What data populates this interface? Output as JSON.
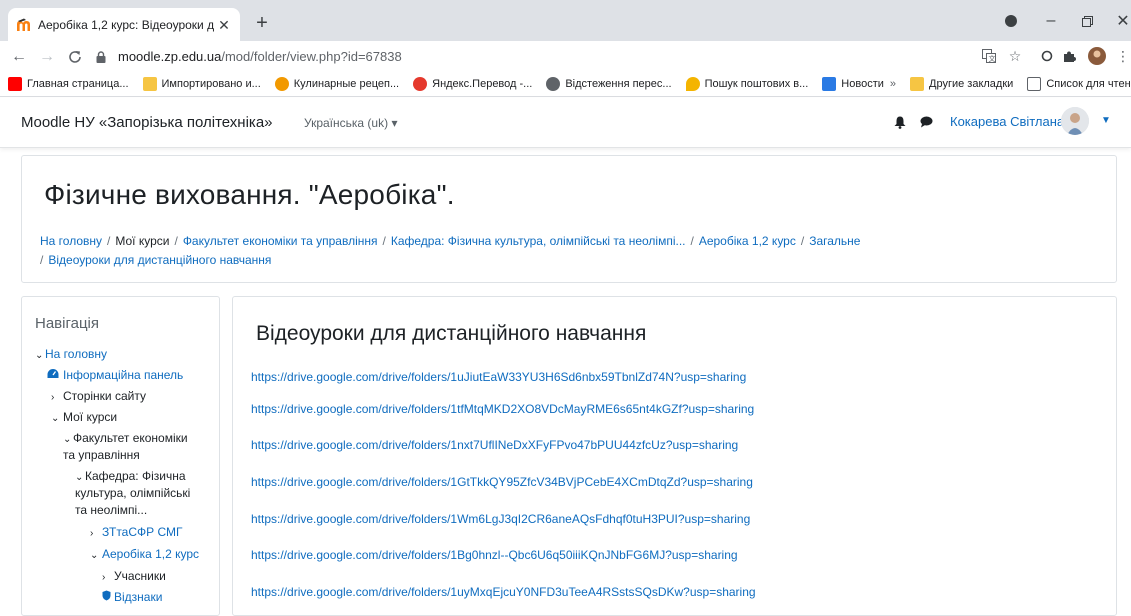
{
  "browser": {
    "tab_title": "Аеробіка 1,2 курс: Відеоуроки д",
    "url_host": "moodle.zp.edu.ua",
    "url_path": "/mod/folder/view.php?id=67838",
    "bookmarks": [
      {
        "label": "Главная страница...",
        "color": "#ff0000"
      },
      {
        "label": "Импортировано и...",
        "color": "#f6c543"
      },
      {
        "label": "Кулинарные рецеп...",
        "color": "#f29900"
      },
      {
        "label": "Яндекс.Перевод -...",
        "color": "#e5392d"
      },
      {
        "label": "Відстеження перес...",
        "color": "#5f6368"
      },
      {
        "label": "Пошук поштових в...",
        "color": "#f4b400"
      },
      {
        "label": "Новости",
        "color": "#2a7ae4"
      }
    ],
    "bookmarks_more": "»",
    "other_bookmarks": "Другие закладки",
    "reading_list": "Список для чтения"
  },
  "navbar": {
    "brand": "Moodle НУ «Запорізька політехніка»",
    "language": "Українська (uk)",
    "user_name": "Кокарева Світлана"
  },
  "header": {
    "course_title": "Фізичне виховання. \"Аеробіка\".",
    "breadcrumb": [
      "На головну",
      "Мої курси",
      "Факультет економіки та управління",
      "Кафедра: Фізична культура, олімпійські та неолімпі...",
      "Аеробіка 1,2 курс",
      "Загальне",
      "Відеоуроки для дистанційного навчання"
    ]
  },
  "navigation": {
    "title": "Навігація",
    "items": [
      "На головну",
      "Інформаційна панель",
      "Сторінки сайту",
      "Мої курси",
      "Факультет економіки",
      "та управління",
      "Кафедра: Фізична",
      "культура, олімпійські",
      "та неолімпі...",
      "ЗТтаСФР СМГ",
      "Аеробіка 1,2 курс",
      "Учасники",
      "Відзнаки"
    ]
  },
  "main": {
    "folder_title": "Відеоуроки для дистанційного навчання",
    "links": [
      "https://drive.google.com/drive/folders/1uJiutEaW33YU3H6Sd6nbx59TbnlZd74N?usp=sharing",
      "https://drive.google.com/drive/folders/1tfMtqMKD2XO8VDcMayRME6s65nt4kGZf?usp=sharing",
      "https://drive.google.com/drive/folders/1nxt7UflINeDxXFyFPvo47bPUU44zfcUz?usp=sharing",
      "https://drive.google.com/drive/folders/1GtTkkQY95ZfcV34BVjPCebE4XCmDtqZd?usp=sharing",
      "https://drive.google.com/drive/folders/1Wm6LgJ3qI2CR6aneAQsFdhqf0tuH3PUI?usp=sharing",
      "https://drive.google.com/drive/folders/1Bg0hnzl--Qbc6U6q50iiiKQnJNbFG6MJ?usp=sharing",
      "https://drive.google.com/drive/folders/1uyMxqEjcuY0NFD3uTeeA4RSstsSQsDKw?usp=sharing"
    ]
  },
  "colors": {
    "link": "#0f6cbf",
    "tabbar": "#dee1e6"
  }
}
